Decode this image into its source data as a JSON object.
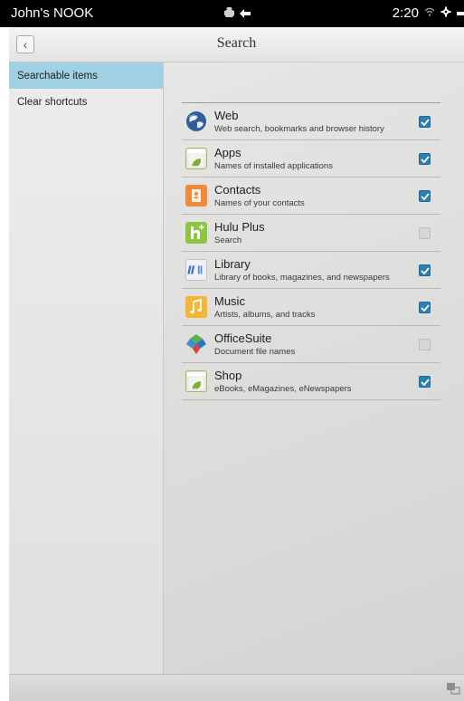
{
  "status_bar": {
    "owner": "John's NOOK",
    "time": "2:20"
  },
  "header": {
    "back_icon": "chevron-left-icon",
    "title": "Search"
  },
  "sidebar": {
    "items": [
      {
        "label": "Searchable items",
        "active": true
      },
      {
        "label": "Clear shortcuts",
        "active": false
      }
    ]
  },
  "searchable_items": [
    {
      "title": "Web",
      "description": "Web search, bookmarks and browser history",
      "checked": true,
      "icon": "globe-icon"
    },
    {
      "title": "Apps",
      "description": "Names of installed applications",
      "checked": true,
      "icon": "apps-icon"
    },
    {
      "title": "Contacts",
      "description": "Names of your contacts",
      "checked": true,
      "icon": "contacts-icon"
    },
    {
      "title": "Hulu Plus",
      "description": "Search",
      "checked": false,
      "icon": "hulu-icon"
    },
    {
      "title": "Library",
      "description": "Library of books, magazines, and newspapers",
      "checked": true,
      "icon": "library-icon"
    },
    {
      "title": "Music",
      "description": "Artists, albums, and tracks",
      "checked": true,
      "icon": "music-icon"
    },
    {
      "title": "OfficeSuite",
      "description": "Document file names",
      "checked": false,
      "icon": "officesuite-icon"
    },
    {
      "title": "Shop",
      "description": "eBooks, eMagazines, eNewspapers",
      "checked": true,
      "icon": "shop-icon"
    }
  ],
  "colors": {
    "active_item": "#9fd0e3",
    "checkbox_on": "#2a80b0",
    "status_bar": "#000000"
  }
}
